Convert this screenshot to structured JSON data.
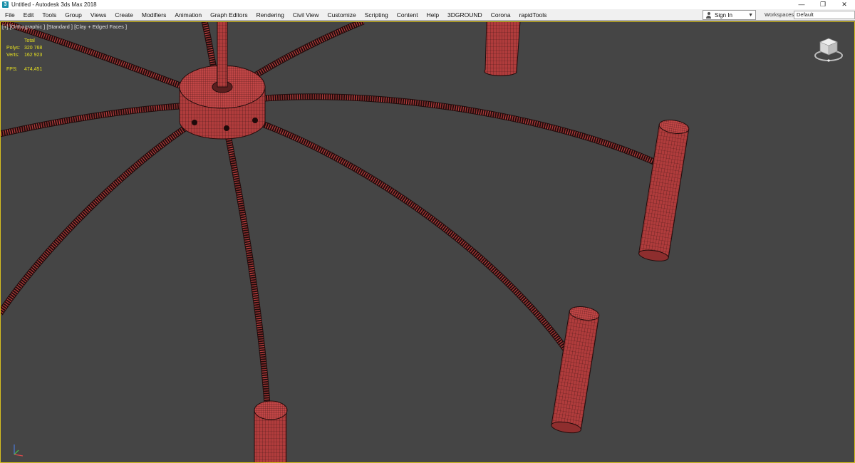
{
  "window": {
    "title": "Untitled - Autodesk 3ds Max 2018",
    "app_icon_glyph": "3",
    "controls": {
      "minimize": "—",
      "restore": "❐",
      "close": "✕"
    }
  },
  "menu": {
    "items": [
      "File",
      "Edit",
      "Tools",
      "Group",
      "Views",
      "Create",
      "Modifiers",
      "Animation",
      "Graph Editors",
      "Rendering",
      "Civil View",
      "Customize",
      "Scripting",
      "Content",
      "Help",
      "3DGROUND",
      "Corona",
      "rapidTools"
    ],
    "sign_in": "Sign In",
    "workspaces_label": "Workspaces:",
    "workspaces_value": "Default"
  },
  "viewport": {
    "label": "[+] [Orthographic ] [Standard ] [Clay + Edged Faces ]",
    "stats": {
      "total_label": "Total",
      "polys_label": "Polys:",
      "polys_value": "320 768",
      "verts_label": "Verts:",
      "verts_value": "162 923",
      "fps_label": "FPS:",
      "fps_value": "474,451"
    },
    "colors": {
      "background": "#454545",
      "mesh": "#b03c3c",
      "mesh_highlight": "#c74a4a",
      "wire": "#1a0a0a",
      "active_border": "#d8c020",
      "stats_text": "#e6e020"
    }
  }
}
